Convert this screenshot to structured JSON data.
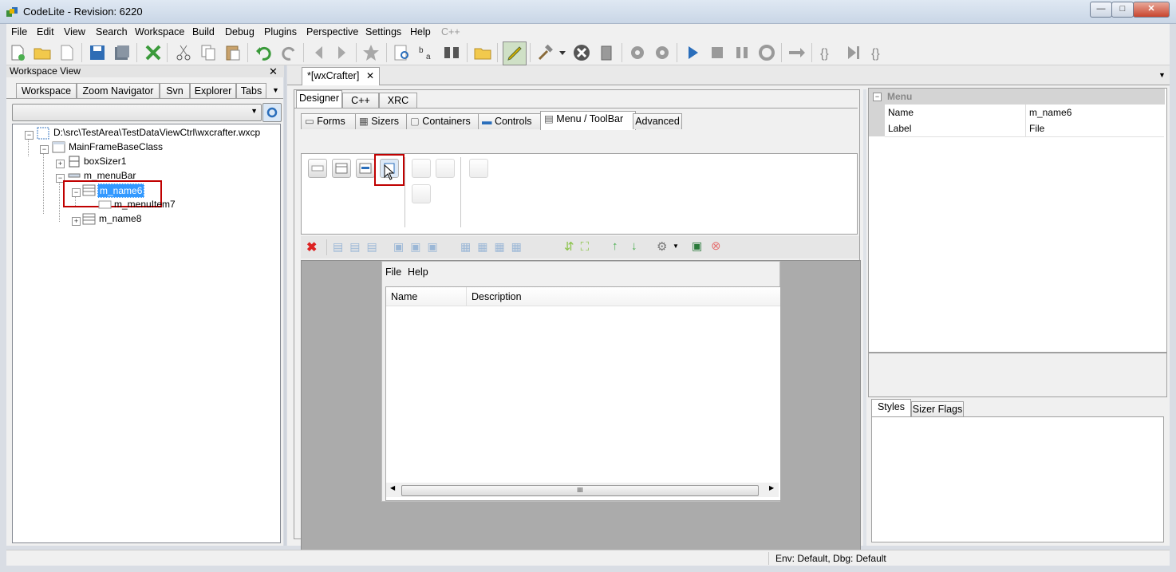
{
  "window": {
    "title": "CodeLite - Revision: 6220"
  },
  "menubar": {
    "items": [
      "File",
      "Edit",
      "View",
      "Search",
      "Workspace",
      "Build",
      "Debug",
      "Plugins",
      "Perspective",
      "Settings",
      "Help",
      "C++"
    ]
  },
  "workspace_view": {
    "title": "Workspace View",
    "tabs": [
      "Workspace",
      "Zoom Navigator",
      "Svn",
      "Explorer",
      "Tabs"
    ],
    "tree": {
      "root": "D:\\src\\TestArea\\TestDataViewCtrl\\wxcrafter.wxcp",
      "main_frame": "MainFrameBaseClass",
      "box_sizer": "boxSizer1",
      "menu_bar": "m_menuBar",
      "menu_selected": "m_name6",
      "menu_item": "m_menuItem7",
      "menu_other": "m_name8"
    }
  },
  "editor": {
    "tab_label": "*[wxCrafter]",
    "view_tabs": [
      "Designer",
      "C++",
      "XRC"
    ],
    "palette_tabs": [
      "Forms",
      "Sizers",
      "Containers",
      "Controls",
      "Menu / ToolBar",
      "Advanced"
    ],
    "preview": {
      "menus": [
        "File",
        "Help"
      ],
      "columns": [
        "Name",
        "Description"
      ],
      "scroll_thumb": "III"
    }
  },
  "properties": {
    "section": "Menu",
    "rows": [
      {
        "key": "Name",
        "value": "m_name6"
      },
      {
        "key": "Label",
        "value": "File"
      }
    ],
    "bottom_tabs": [
      "Styles",
      "Sizer Flags"
    ]
  },
  "status": {
    "text": "Env: Default, Dbg: Default"
  },
  "colors": {
    "selection": "#3399ff",
    "highlight_box": "#c00000",
    "accent_blue": "#2a6ebb"
  }
}
